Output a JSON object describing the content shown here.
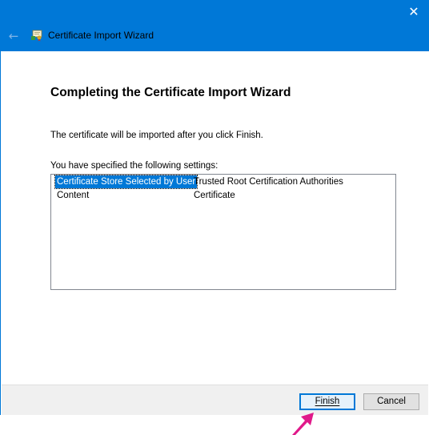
{
  "window": {
    "title": "Certificate Import Wizard",
    "close_glyph": "✕",
    "back_glyph": "←"
  },
  "main": {
    "heading": "Completing the Certificate Import Wizard",
    "description": "The certificate will be imported after you click Finish.",
    "settings_label": "You have specified the following settings:",
    "settings": [
      {
        "key": "Certificate Store Selected by User",
        "value": "Trusted Root Certification Authorities",
        "selected": true
      },
      {
        "key": "Content",
        "value": "Certificate",
        "selected": false
      }
    ]
  },
  "footer": {
    "finish_label": "Finish",
    "cancel_label": "Cancel"
  },
  "annotation": {
    "arrow_color": "#e0198a",
    "icon": "arrow-pointer-icon"
  },
  "colors": {
    "titlebar": "#0078d7",
    "footer_bg": "#f0f0f0",
    "selection": "#0078d7"
  }
}
